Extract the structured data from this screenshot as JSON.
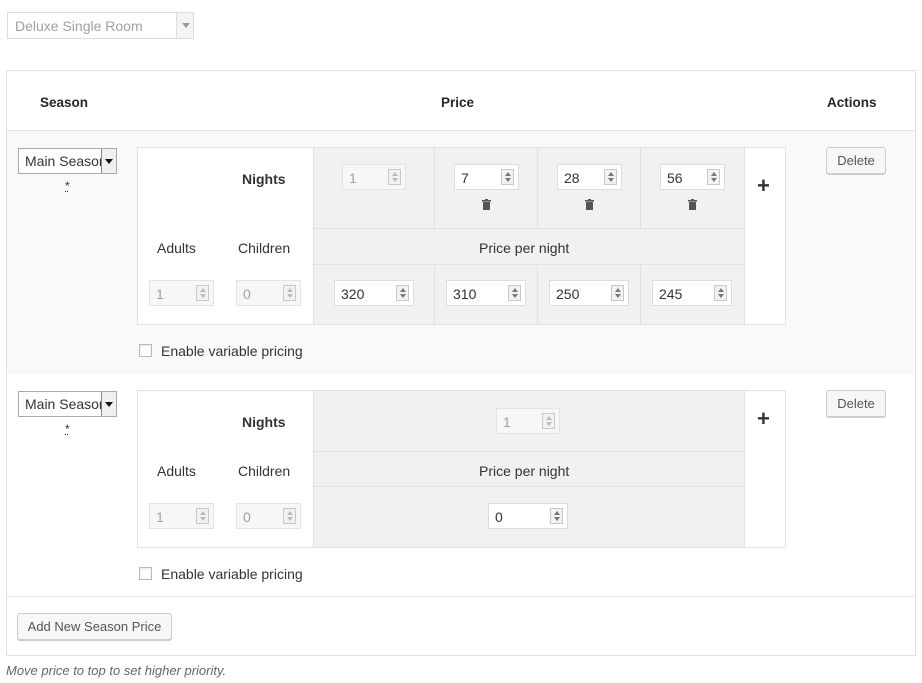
{
  "room_select": {
    "value": "Deluxe Single Room"
  },
  "table": {
    "headers": {
      "season": "Season",
      "price": "Price",
      "actions": "Actions"
    }
  },
  "labels": {
    "nights": "Nights",
    "adults": "Adults",
    "children": "Children",
    "price_per_night": "Price per night",
    "enable_variable": "Enable variable pricing",
    "delete": "Delete",
    "required": "*",
    "plus": "+"
  },
  "rows": [
    {
      "season": "Main Season",
      "nights": [
        "1",
        "7",
        "28",
        "56"
      ],
      "adults": "1",
      "children": "0",
      "prices": [
        "320",
        "310",
        "250",
        "245"
      ]
    },
    {
      "season": "Main Season",
      "nights": [
        "1"
      ],
      "adults": "1",
      "children": "0",
      "prices": [
        "0"
      ]
    }
  ],
  "add_button": "Add New Season Price",
  "hint": "Move price to top to set higher priority.",
  "icons": {
    "trash": "trash-icon",
    "plus": "plus-icon",
    "dropdown": "chevron-down-icon"
  }
}
